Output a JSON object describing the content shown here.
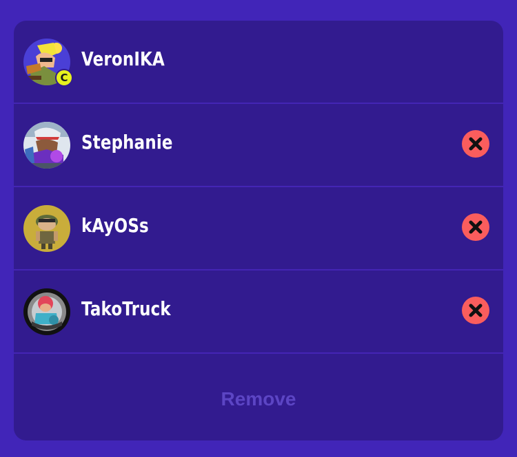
{
  "members": [
    {
      "name": "VeronIKA",
      "badge": "C",
      "removable": false,
      "avatar_icon": "inkling-yellow-avatar"
    },
    {
      "name": "Stephanie",
      "removable": true,
      "avatar_icon": "inkling-purple-avatar"
    },
    {
      "name": "kAyOSs",
      "removable": true,
      "avatar_icon": "smallfry-avatar"
    },
    {
      "name": "TakoTruck",
      "removable": true,
      "avatar_icon": "octoling-avatar"
    }
  ],
  "footer": {
    "remove_label": "Remove"
  },
  "colors": {
    "background": "#4125b8",
    "panel": "#321b8f",
    "divider": "#4425b5",
    "remove_icon_bg": "#fa5d5d",
    "captain_badge": "#e6f01e",
    "remove_disabled_text": "#5c45c4"
  }
}
